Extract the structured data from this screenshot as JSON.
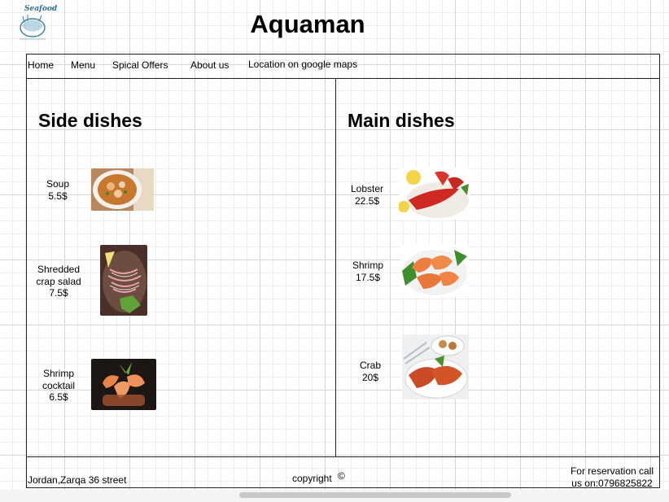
{
  "header": {
    "title": "Aquaman",
    "logo": {
      "text": "Seafood",
      "icon": "shrimp-logo-icon"
    }
  },
  "nav": {
    "items": [
      {
        "label": "Home"
      },
      {
        "label": "Menu"
      },
      {
        "label": "Spical Offers"
      },
      {
        "label": "About us"
      },
      {
        "label": "Location on google maps"
      }
    ]
  },
  "side": {
    "heading": "Side dishes",
    "dishes": [
      {
        "name": "Soup",
        "price": "5.5$",
        "image": "soup-bowl-photo"
      },
      {
        "name": "Shredded crap salad",
        "price": "7.5$",
        "image": "crab-salad-photo"
      },
      {
        "name": "Shrimp cocktail",
        "price": "6.5$",
        "image": "shrimp-cocktail-photo"
      }
    ]
  },
  "main": {
    "heading": "Main dishes",
    "dishes": [
      {
        "name": "Lobster",
        "price": "22.5$",
        "image": "lobster-photo"
      },
      {
        "name": "Shrimp",
        "price": "17.5$",
        "image": "shrimp-plate-photo"
      },
      {
        "name": "Crab",
        "price": "20$",
        "image": "crab-plate-photo"
      }
    ]
  },
  "footer": {
    "address": "Jordan,Zarqa 36 street",
    "copyright": "copyright",
    "copyright_symbol": "©",
    "reservation_line1": "For reservation call",
    "reservation_line2": "us on:0796825822"
  }
}
